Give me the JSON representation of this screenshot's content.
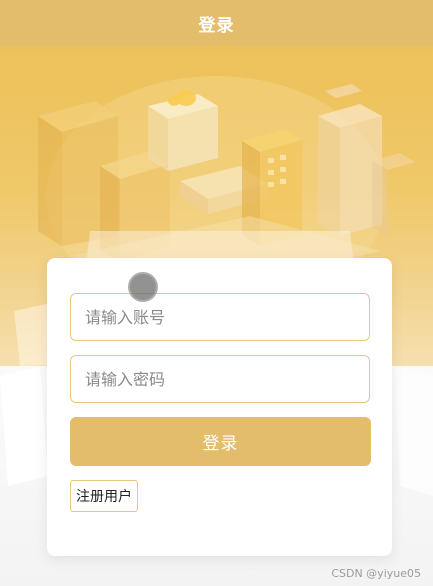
{
  "header": {
    "title": "登录"
  },
  "form": {
    "account_placeholder": "请输入账号",
    "password_placeholder": "请输入密码",
    "login_label": "登录",
    "register_label": "注册用户"
  },
  "watermark": "CSDN @yiyue05",
  "colors": {
    "accent": "#e3bd6c",
    "input_border": "#e6c583",
    "hero_top": "#edc15a"
  }
}
